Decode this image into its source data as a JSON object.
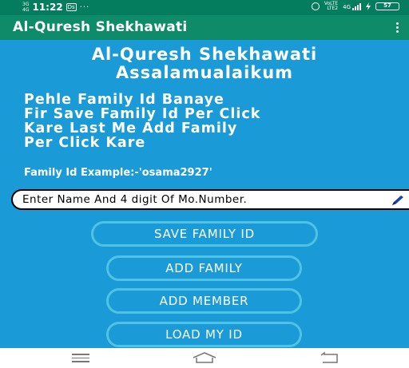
{
  "status_bar": {
    "network_top": "3G",
    "network_bottom": "4G",
    "time": "11:22",
    "notification_badge": "Ds",
    "dots": "···",
    "lte_top": "VoLTE",
    "lte_bottom": "LTE2",
    "signal_label": "4G",
    "battery": "57"
  },
  "app_bar": {
    "title": "Al-Quresh Shekhawati",
    "menu_icon": "more-vertical-icon"
  },
  "heading": {
    "line1": "Al-Quresh Shekhawati",
    "line2": "Assalamualaikum"
  },
  "instructions": {
    "line1": "Pehle Family Id Banaye",
    "line2": "Fir Save Family Id Per Click",
    "line3": "Kare Last Me Add Family",
    "line4": "Per Click Kare"
  },
  "example_text": "Family Id Example:-'osama2927'",
  "family_id_input": {
    "placeholder": "Enter Name And 4 digit Of Mo.Number.",
    "value": ""
  },
  "buttons": {
    "save_family_id": "SAVE FAMILY ID",
    "add_family": "ADD FAMILY",
    "add_member": "ADD MEMBER",
    "load_my_id": "LOAD MY ID"
  },
  "nav_bar": {
    "menu_icon": "menu-icon",
    "home_icon": "home-icon",
    "back_icon": "back-icon"
  },
  "colors": {
    "background": "#1a9ad6",
    "status_bar": "#047d5f",
    "app_bar": "#0e8b68",
    "button_border": "#4fc3e3"
  }
}
